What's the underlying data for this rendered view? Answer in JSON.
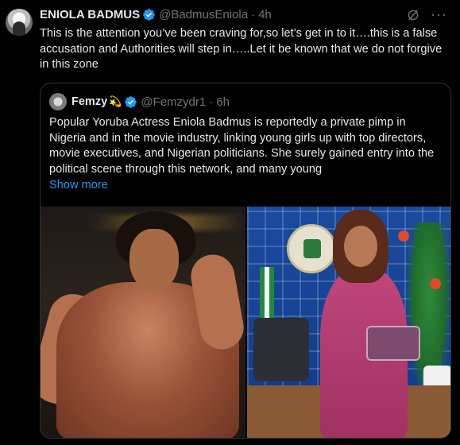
{
  "author": {
    "name": "ENIOLA BADMUS",
    "handle": "@BadmusEniola",
    "separator": "·",
    "time": "4h"
  },
  "tweet_text": "This is the attention you’ve been craving for,so let’s get in to it….this is a false accusation and Authorities will step in…..Let it be known that we do not forgive in this zone",
  "more_icon": "···",
  "quoted": {
    "name": "Femzy",
    "emoji": "💫",
    "handle": "@Femzydr1",
    "separator": "·",
    "time": "6h",
    "text": "Popular Yoruba Actress Eniola Badmus is reportedly a private pimp in Nigeria and in the movie industry, linking young girls up with top directors, movie executives, and Nigerian politicians. She surely gained entry into the political scene through this network, and many young",
    "show_more": "Show more"
  },
  "colors": {
    "background": "#000000",
    "text": "#e7e9ea",
    "muted": "#71767b",
    "link": "#1d9bf0",
    "verified": "#1d9bf0",
    "border": "#2f3336"
  },
  "icons": [
    "verified-badge-icon",
    "grok-icon",
    "more-icon"
  ]
}
